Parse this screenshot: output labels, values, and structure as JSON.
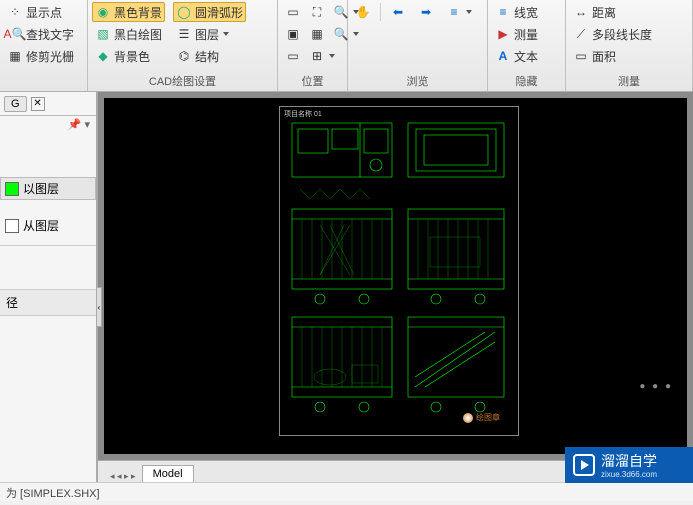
{
  "ribbon": {
    "groups": [
      {
        "label": "",
        "buttons": [
          {
            "name": "show-points",
            "icon": "•",
            "text": "显示点",
            "active": false
          },
          {
            "name": "find-text",
            "icon": "A",
            "text": "查找文字",
            "active": false
          },
          {
            "name": "trim-grid",
            "icon": "▦",
            "text": "修剪光栅",
            "active": false
          }
        ]
      },
      {
        "label": "CAD绘图设置",
        "buttons": [
          {
            "name": "black-bg",
            "icon": "◎",
            "text": "黑色背景",
            "active": true
          },
          {
            "name": "bw-draw",
            "icon": "▧",
            "text": "黑白绘图",
            "active": false
          },
          {
            "name": "bg-color",
            "icon": "◆",
            "text": "背景色",
            "active": false
          }
        ],
        "buttons2": [
          {
            "name": "smooth-arc",
            "icon": "◎",
            "text": "圆滑弧形",
            "active": true
          },
          {
            "name": "layers",
            "icon": "☰",
            "text": "图层",
            "active": false
          },
          {
            "name": "structure",
            "icon": "⌬",
            "text": "结构",
            "active": false
          }
        ]
      },
      {
        "label": "位置",
        "small": true
      },
      {
        "label": "浏览",
        "nav": true
      },
      {
        "label": "隐藏",
        "buttons": [
          {
            "name": "line-width",
            "icon": "≡",
            "text": "线宽",
            "active": false
          },
          {
            "name": "measure",
            "icon": "▶",
            "text": "测量",
            "active": false
          },
          {
            "name": "text",
            "icon": "A",
            "text": "文本",
            "active": false
          }
        ]
      },
      {
        "label": "测量",
        "buttons": [
          {
            "name": "distance",
            "icon": "↔",
            "text": "距离",
            "active": false
          },
          {
            "name": "poly-length",
            "icon": "⟋",
            "text": "多段线长度",
            "active": false
          },
          {
            "name": "area",
            "icon": "▭",
            "text": "面积",
            "active": false
          }
        ]
      }
    ]
  },
  "sidepanel": {
    "tab": "G",
    "pin": "⬘",
    "rows": [
      {
        "color": "green",
        "label": "以图层",
        "selected": true
      },
      {
        "color": "white",
        "label": "从图层",
        "selected": false
      }
    ],
    "section": "径"
  },
  "canvas": {
    "sheet_label": "项目名称  01"
  },
  "tabs": {
    "model": "Model"
  },
  "status": {
    "text": "为 [SIMPLEX.SHX]"
  },
  "watermark": {
    "brand": "溜溜自学",
    "sub": "zixue.3d66.com"
  }
}
